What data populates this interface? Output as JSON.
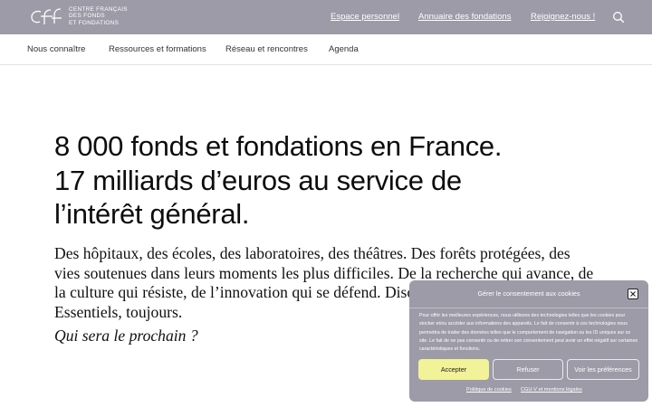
{
  "header": {
    "logo_lines": [
      "CENTRE FRANÇAIS",
      "DES FONDS",
      "ET FONDATIONS"
    ],
    "links": [
      "Espace personnel",
      "Annuaire des fondations",
      "Rejoignez-nous !"
    ],
    "search_icon": "search-icon"
  },
  "nav": {
    "items": [
      "Nous connaître",
      "Ressources et formations",
      "Réseau et rencontres",
      "Agenda"
    ]
  },
  "hero": {
    "headline_lines": [
      "8 000 fonds et fondations en France.",
      "17 milliards d’euros au service de",
      "l’intérêt général."
    ],
    "body": "Des hôpitaux, des écoles, des laboratoires, des théâtres. Des forêts protégées, des vies soutenues dans leurs moments les plus difficiles. De la recherche qui avance, de la culture qui résiste, de l’innovation qui se défend. Discrets, souvent méconnus. Essentiels, toujours.",
    "tagline": "Qui sera le prochain ?"
  },
  "cookie_banner": {
    "title": "Gérer le consentement aux cookies",
    "body": "Pour offrir les meilleures expériences, nous utilisons des technologies telles que les cookies pour stocker et/ou accéder aux informations des appareils. Le fait de consentir à ces technologies nous permettra de traiter des données telles que le comportement de navigation ou les ID uniques sur ce site. Le fait de ne pas consentir ou de retirer son consentement peut avoir un effet négatif sur certaines caractéristiques et fonctions.",
    "accept_label": "Accepter",
    "refuse_label": "Refuser",
    "prefs_label": "Voir les préférences",
    "links": [
      "Politique de cookies",
      "CGU-V et mentions légales"
    ],
    "close_icon": "close-icon"
  },
  "colors": {
    "header_bg": "#9c9ba7",
    "accept_bg": "#f2f298"
  }
}
